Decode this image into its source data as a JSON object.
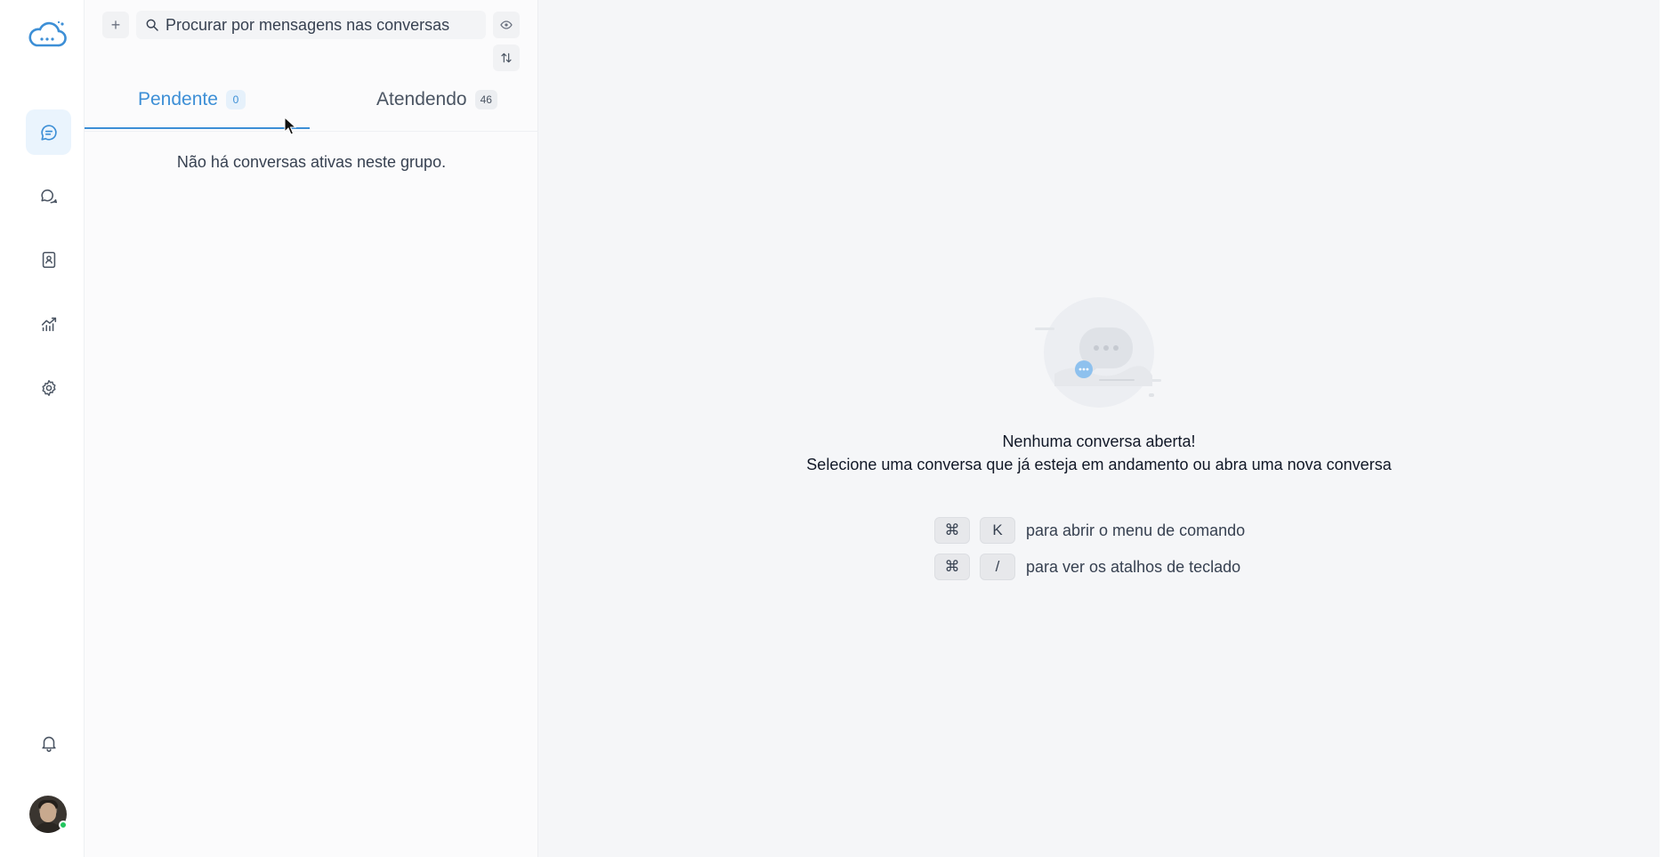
{
  "search": {
    "placeholder": "Procurar por mensagens nas conversas"
  },
  "tabs": [
    {
      "label": "Pendente",
      "count": "0"
    },
    {
      "label": "Atendendo",
      "count": "46"
    }
  ],
  "conversation_list": {
    "empty_text": "Não há conversas ativas neste grupo."
  },
  "main": {
    "title": "Nenhuma conversa aberta!",
    "subtitle": "Selecione uma conversa que já esteja em andamento ou abra uma nova conversa",
    "shortcuts": [
      {
        "mod": "⌘",
        "key": "K",
        "desc": "para abrir o menu de comando"
      },
      {
        "mod": "⌘",
        "key": "/",
        "desc": "para ver os atalhos de teclado"
      }
    ]
  },
  "toolbar": {
    "add_glyph": "+"
  },
  "colors": {
    "accent": "#3d8fd6",
    "panel_bg": "#fbfbfc",
    "main_bg": "#f5f6f8",
    "online": "#22c55e"
  }
}
